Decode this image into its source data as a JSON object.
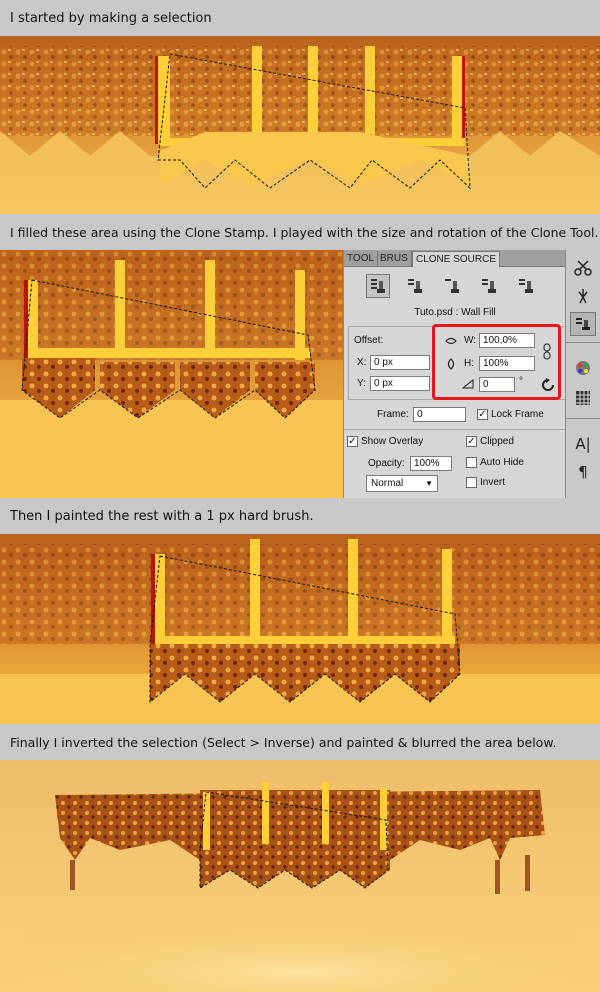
{
  "captions": [
    "I started by making a selection",
    "I filled these area using the Clone Stamp. I played with the size and rotation of the Clone Tool.",
    "Then I painted the rest with a 1 px hard brush.",
    "Finally I inverted the selection (Select > Inverse) and painted & blurred the area below."
  ],
  "panel": {
    "tabs": [
      "TOOL",
      "BRUS",
      "CLONE SOURCE"
    ],
    "menu_glyph": "▸▸ ≡",
    "doc_label": "Tuto.psd : Wall Fill",
    "offset_label": "Offset:",
    "x_label": "X:",
    "x_value": "0 px",
    "y_label": "Y:",
    "y_value": "0 px",
    "w_label": "W:",
    "w_value": "100,0%",
    "h_label": "H:",
    "h_value": "100%",
    "angle_value": "0",
    "degree": "°",
    "frame_label": "Frame:",
    "frame_value": "0",
    "lock_frame": "Lock Frame",
    "show_overlay": "Show Overlay",
    "clipped": "Clipped",
    "opacity_label": "Opacity:",
    "opacity_value": "100%",
    "auto_hide": "Auto Hide",
    "blend_mode": "Normal",
    "invert": "Invert",
    "checks": {
      "check_mark": "✓"
    }
  },
  "side_tools": [
    "scissors-icon",
    "puppet-icon",
    "clone-source-icon",
    "swatches-icon",
    "grid-icon",
    "character-icon",
    "paragraph-icon"
  ],
  "side_glyphs": {
    "char": "A|",
    "para": "¶"
  },
  "colors": {
    "highlight": "#e8141b",
    "gold": "#f9c64e",
    "copper": "#b45a18"
  }
}
